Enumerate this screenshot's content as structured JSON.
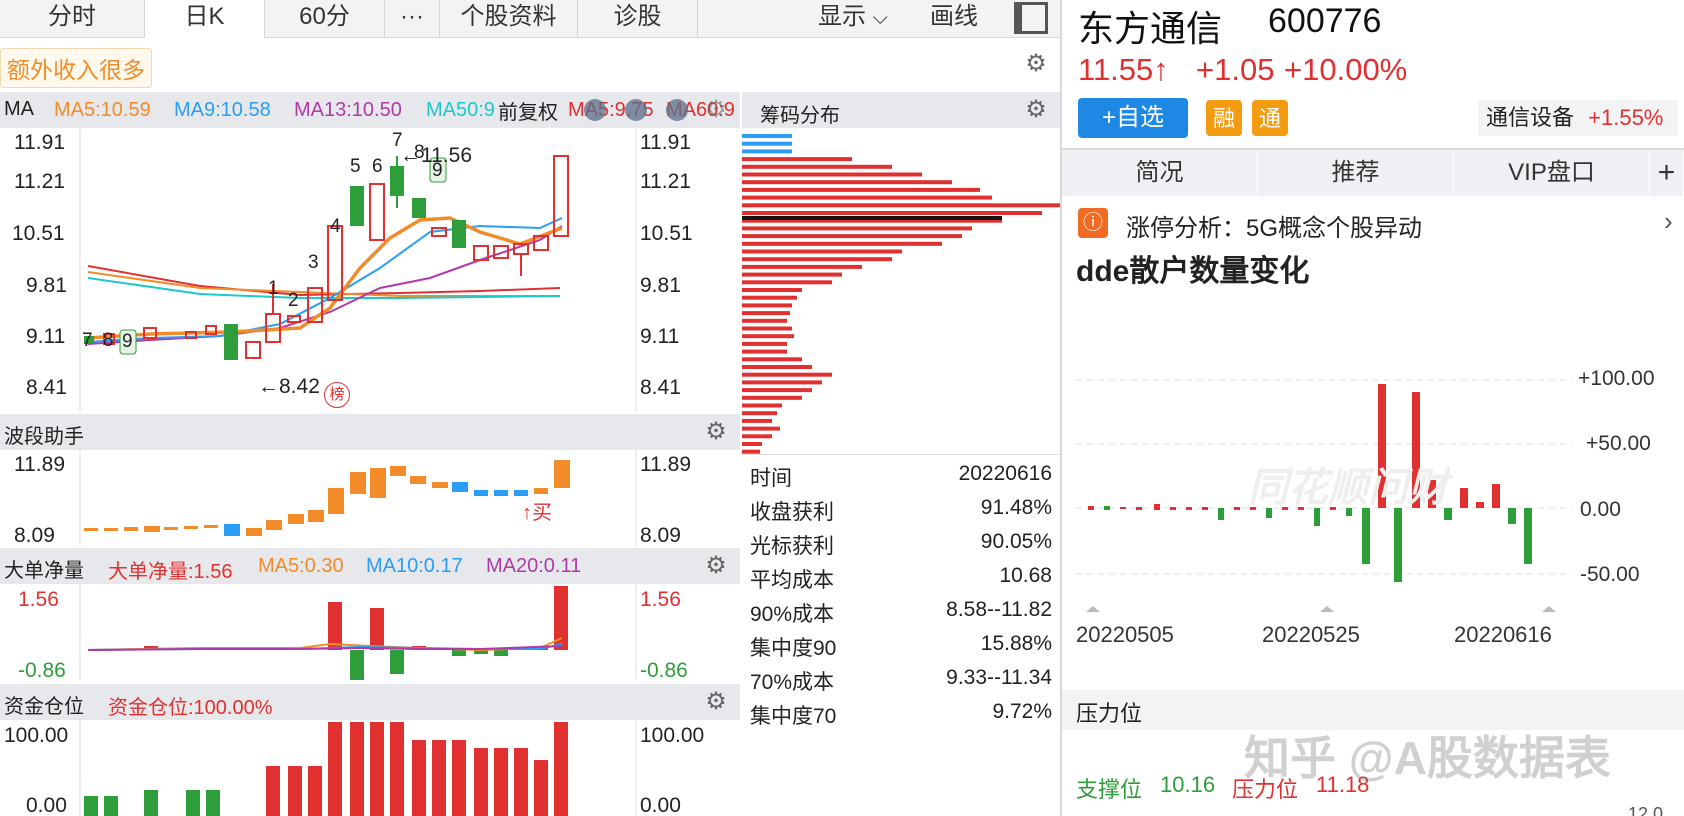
{
  "toolbar": {
    "tabs": [
      "分时",
      "日K",
      "60分",
      "···",
      "个股资料",
      "诊股"
    ],
    "active_tab": "日K",
    "display_label": "显示",
    "draw_label": "画线"
  },
  "banner": {
    "text": "额外收入很多"
  },
  "ma_legend": {
    "ma": "MA",
    "ma5": "MA5:10.59",
    "ma9": "MA9:10.58",
    "ma13": "MA13:10.50",
    "ma50": "MA50:9.",
    "qfq": "前复权",
    "ma_extra": "MA5:9.75",
    "ma60": "MA60:9"
  },
  "kline_axis": [
    "11.91",
    "11.21",
    "10.51",
    "9.81",
    "9.11",
    "8.41"
  ],
  "kline_annotations": {
    "high": "11.56",
    "low": "8.42",
    "seq_a": [
      "7",
      "8",
      "9"
    ],
    "seq_b": [
      "1",
      "2",
      "3",
      "4",
      "5",
      "6",
      "7",
      "8",
      "9"
    ],
    "rank_badge": "榜"
  },
  "chips": {
    "title": "筹码分布",
    "stats": [
      {
        "k": "时间",
        "v": "20220616"
      },
      {
        "k": "收盘获利",
        "v": "91.48%"
      },
      {
        "k": "光标获利",
        "v": "90.05%"
      },
      {
        "k": "平均成本",
        "v": "10.68"
      },
      {
        "k": "90%成本",
        "v": "8.58--11.82"
      },
      {
        "k": "集中度90",
        "v": "15.88%"
      },
      {
        "k": "70%成本",
        "v": "9.33--11.34"
      },
      {
        "k": "集中度70",
        "v": "9.72%"
      }
    ]
  },
  "wave": {
    "title": "波段助手",
    "axis_top": "11.89",
    "axis_bottom": "8.09",
    "buy_label": "↑买"
  },
  "big_order": {
    "title": "大单净量",
    "value": "大单净量:1.56",
    "ma5": "MA5:0.30",
    "ma10": "MA10:0.17",
    "ma20": "MA20:0.11",
    "axis_top": "1.56",
    "axis_bottom": "-0.86"
  },
  "position": {
    "title": "资金仓位",
    "value": "资金仓位:100.00%",
    "axis_top": "100.00",
    "axis_bottom": "0.00"
  },
  "stock": {
    "name": "东方通信",
    "code": "600776",
    "price": "11.55↑",
    "change": "+1.05",
    "pct": "+10.00%",
    "add_watch": "+自选",
    "tag_rong": "融",
    "tag_tong": "通",
    "sector": "通信设备",
    "sector_pct": "+1.55%"
  },
  "right_tabs": [
    "简况",
    "推荐",
    "VIP盘口",
    "+"
  ],
  "news": {
    "text": "涨停分析：5G概念个股异动"
  },
  "dde": {
    "title": "dde散户数量变化",
    "watermark": "同花顺问财",
    "y_labels": [
      "+100.00",
      "+50.00",
      "0.00",
      "-50.00"
    ],
    "x_labels": [
      "20220505",
      "20220525",
      "20220616"
    ]
  },
  "pressure": {
    "title": "压力位",
    "support_label": "支撑位",
    "support_value": "10.16",
    "resist_label": "压力位",
    "resist_value": "11.18",
    "partial": "12.0"
  },
  "watermark": {
    "text": "知乎 @A股数据表"
  },
  "colors": {
    "up": "#e03030",
    "down": "#2e9e3a",
    "ma5": "#f28c28",
    "ma9": "#2a9df4",
    "ma13": "#b03aa8",
    "ma50": "#1ec8c8"
  }
}
